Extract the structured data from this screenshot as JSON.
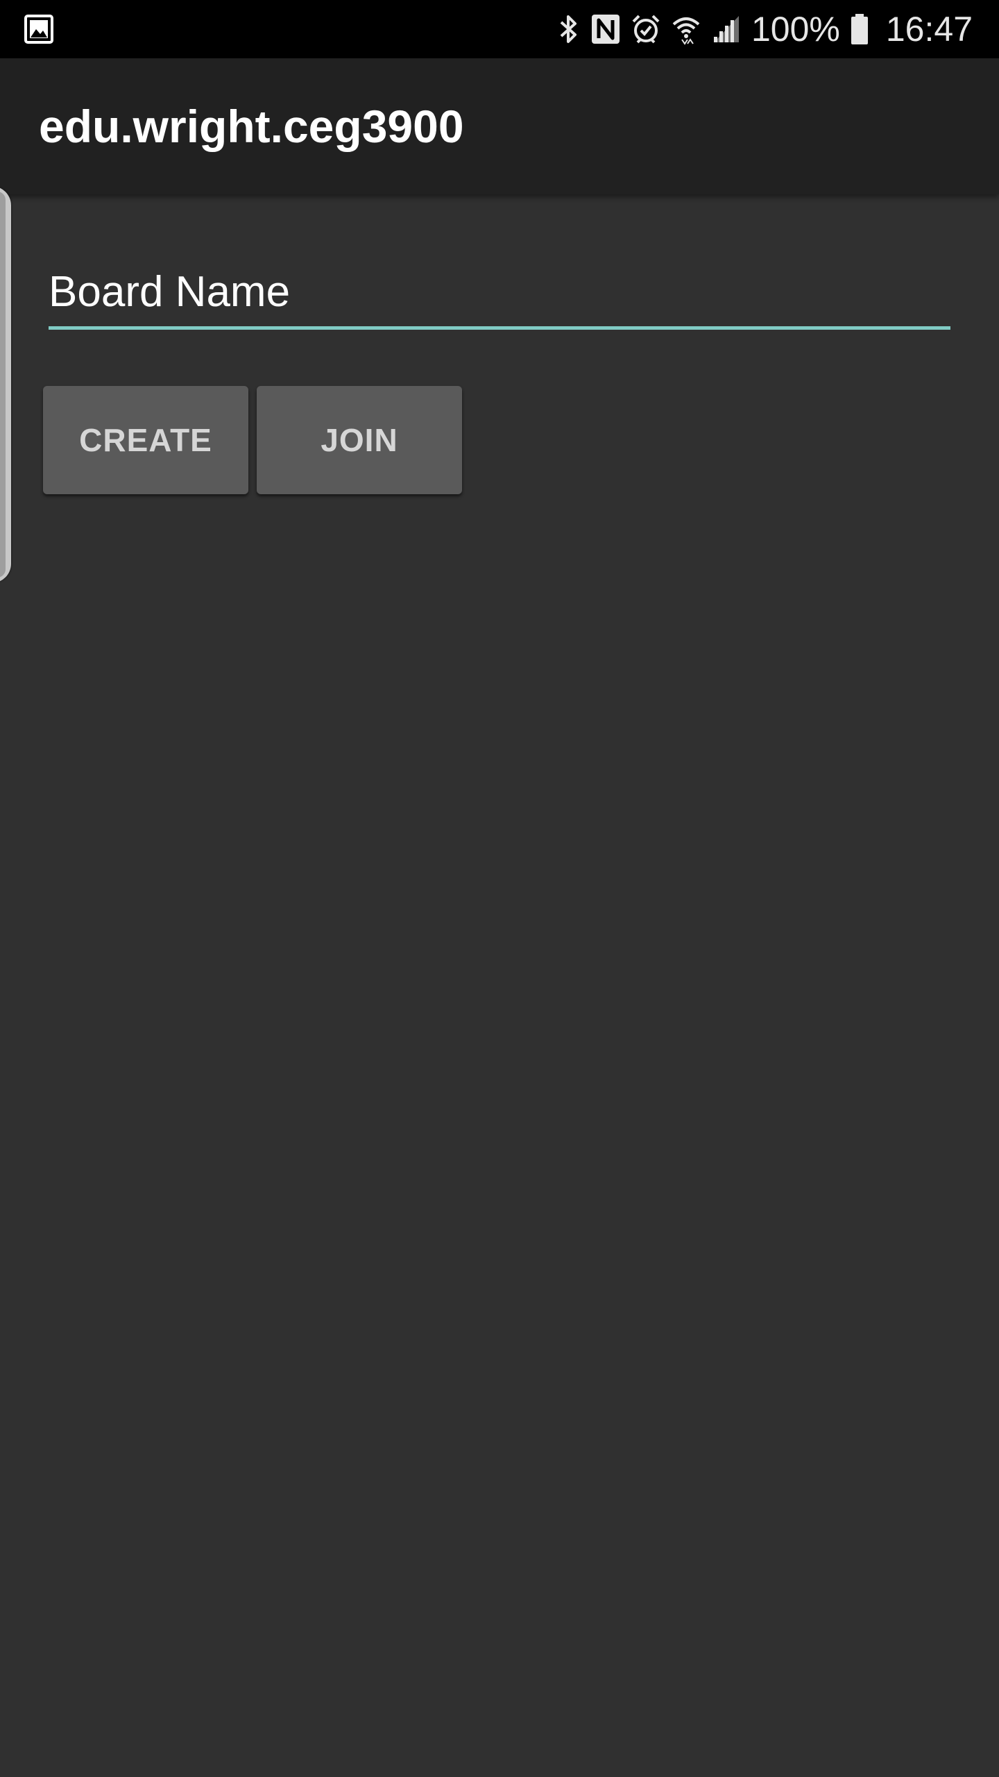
{
  "status_bar": {
    "left_icon": "gallery-notification-icon",
    "icons": [
      "bluetooth-icon",
      "nfc-icon",
      "alarm-icon",
      "wifi-icon",
      "cell-signal-icon"
    ],
    "battery_percent": "100%",
    "battery_icon": "battery-full-icon",
    "time": "16:47"
  },
  "app_bar": {
    "title": "edu.wright.ceg3900"
  },
  "form": {
    "board_name_value": "",
    "board_name_placeholder": "Board Name",
    "create_label": "CREATE",
    "join_label": "JOIN"
  },
  "colors": {
    "status_bar_bg": "#000000",
    "app_bar_bg": "#212121",
    "content_bg": "#303030",
    "input_underline": "#80cbc4",
    "button_bg": "#5a5a5a",
    "button_text": "#d6d6d6"
  }
}
